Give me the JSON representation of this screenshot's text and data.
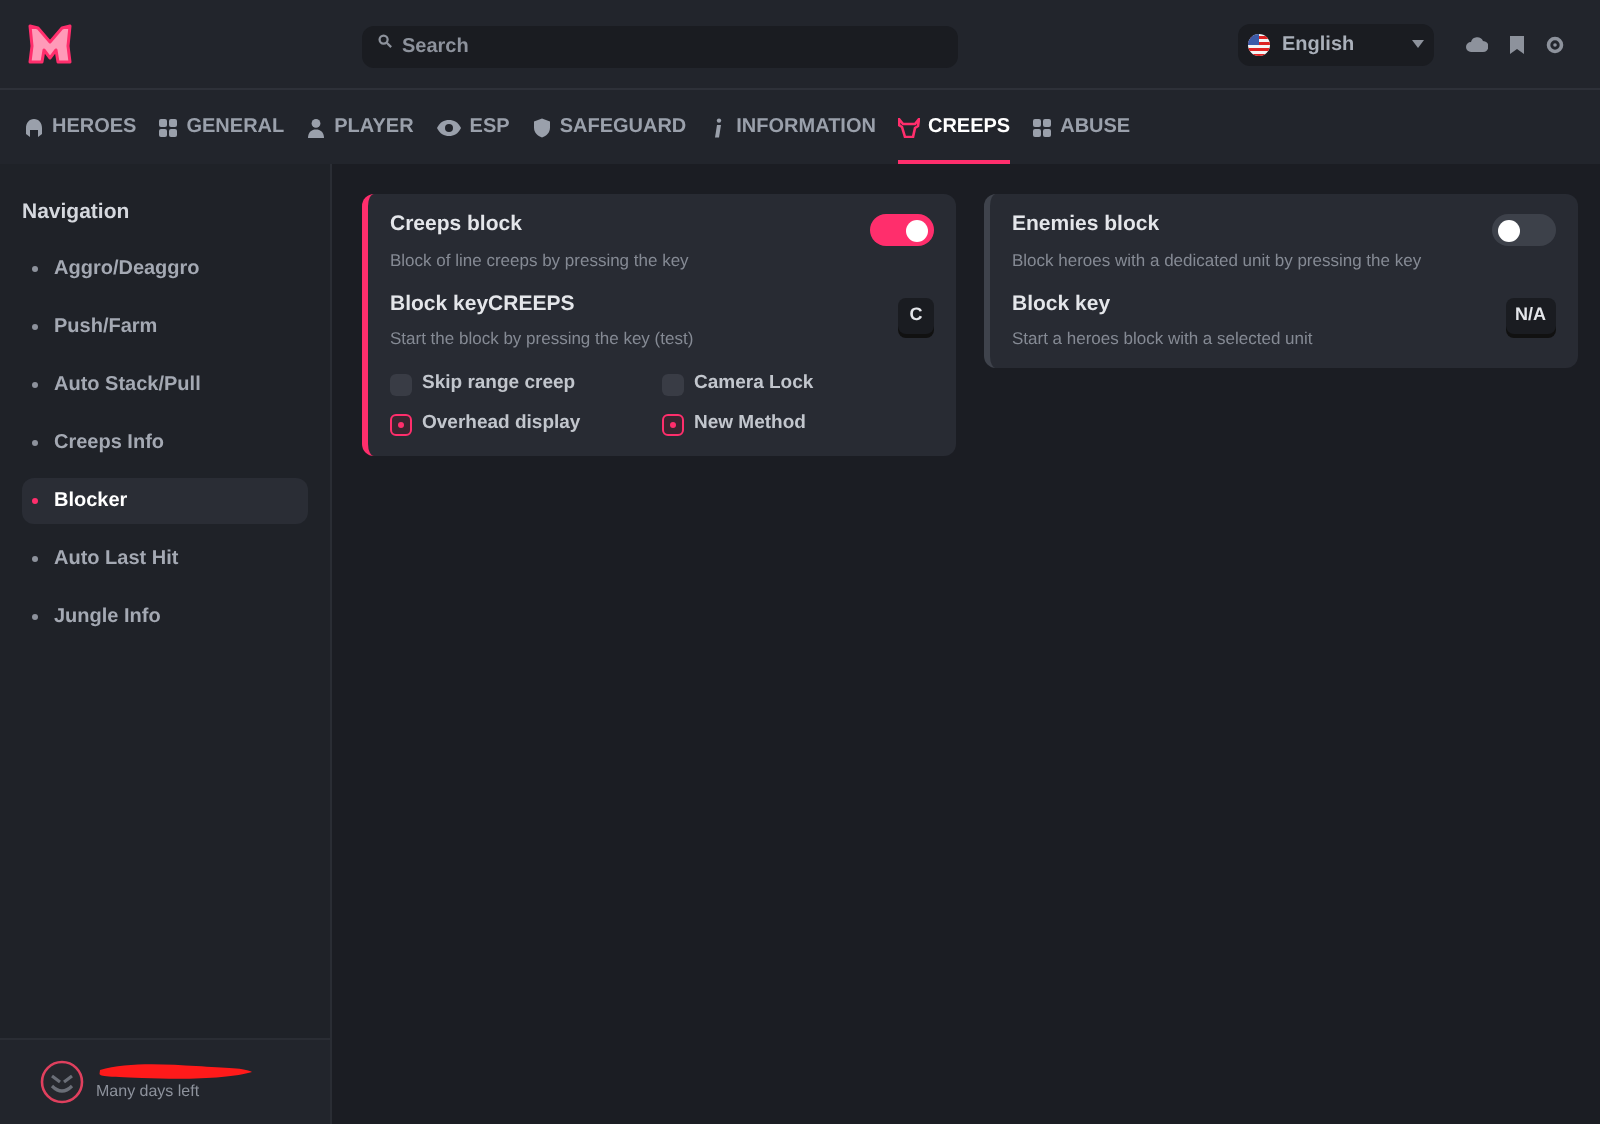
{
  "header": {
    "search": {
      "placeholder": "Search"
    },
    "language": {
      "label": "English"
    }
  },
  "tabs": [
    {
      "label": "HEROES",
      "kind": "helmet",
      "selected": false
    },
    {
      "label": "GENERAL",
      "kind": "grid",
      "selected": false
    },
    {
      "label": "PLAYER",
      "kind": "person",
      "selected": false
    },
    {
      "label": "ESP",
      "kind": "eye",
      "selected": false
    },
    {
      "label": "SAFEGUARD",
      "kind": "shield",
      "selected": false
    },
    {
      "label": "INFORMATION",
      "kind": "info",
      "selected": false
    },
    {
      "label": "CREEPS",
      "kind": "bull",
      "selected": true
    },
    {
      "label": "ABUSE",
      "kind": "grid",
      "selected": false
    }
  ],
  "sidebar": {
    "title": "Navigation",
    "items": [
      {
        "label": "Aggro/Deaggro",
        "selected": false
      },
      {
        "label": "Push/Farm",
        "selected": false
      },
      {
        "label": "Auto Stack/Pull",
        "selected": false
      },
      {
        "label": "Creeps Info",
        "selected": false
      },
      {
        "label": "Blocker",
        "selected": true
      },
      {
        "label": "Auto Last Hit",
        "selected": false
      },
      {
        "label": "Jungle Info",
        "selected": false
      }
    ],
    "user": {
      "status": "Many days left"
    }
  },
  "cards": [
    {
      "rows": [
        {
          "kind": "toggle",
          "title": "Creeps block",
          "description": "Block of line creeps by pressing the key",
          "on": true
        },
        {
          "kind": "key",
          "title": "Block keyCREEPS",
          "description": "Start the block by pressing the key  (test)",
          "key": "C"
        }
      ],
      "checkboxes": [
        {
          "label": "Skip range creep",
          "checked": false
        },
        {
          "label": "Camera Lock",
          "checked": false
        },
        {
          "label": "Overhead display",
          "checked": true
        },
        {
          "label": "New Method",
          "checked": true
        }
      ]
    },
    {
      "rows": [
        {
          "kind": "toggle",
          "title": "Enemies block",
          "description": "Block heroes with a dedicated unit by pressing the key",
          "on": false
        },
        {
          "kind": "key",
          "title": "Block key",
          "description": "Start a heroes block with a selected unit",
          "key": "N/A"
        }
      ]
    }
  ]
}
